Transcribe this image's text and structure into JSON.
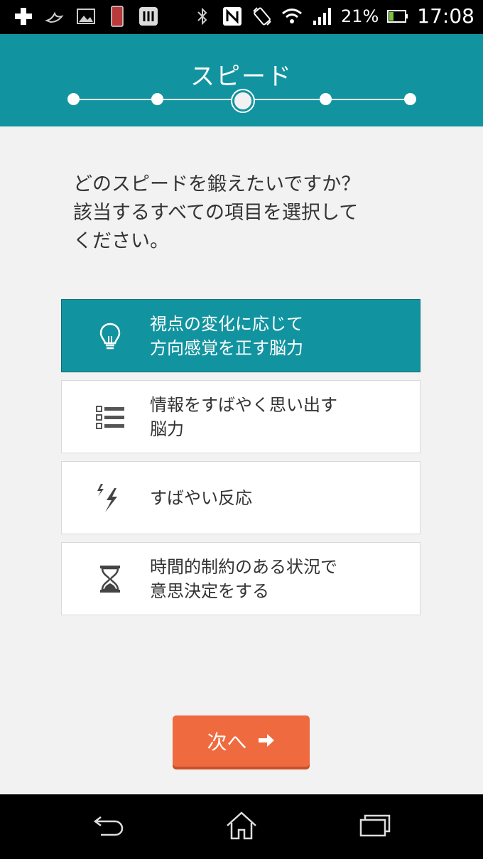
{
  "status_bar": {
    "icons_left": [
      "add-icon",
      "bird-icon",
      "image-icon",
      "phone-icon",
      "app-icon"
    ],
    "icons_right": [
      "bluetooth-icon",
      "nfc-icon",
      "rotate-icon",
      "wifi-icon",
      "signal-icon",
      "battery-icon"
    ],
    "battery_percent": "21%",
    "time": "17:08"
  },
  "header": {
    "title": "スピード",
    "steps_total": 5,
    "current_step": 3
  },
  "question": {
    "text": "どのスピードを鍛えたいですか？\n該当するすべての項目を選択して\nください。"
  },
  "options": [
    {
      "label": "視点の変化に応じて\n方向感覚を正す脳力",
      "icon": "lightbulb-icon",
      "selected": true
    },
    {
      "label": "情報をすばやく思い出す\n脳力",
      "icon": "list-icon",
      "selected": false
    },
    {
      "label": "すばやい反応",
      "icon": "lightning-icon",
      "selected": false
    },
    {
      "label": "時間的制約のある状況で\n意思決定をする",
      "icon": "hourglass-icon",
      "selected": false
    }
  ],
  "next_button": {
    "label": "次へ",
    "icon": "arrow-right-icon"
  },
  "nav_bar": {
    "buttons": [
      "back-icon",
      "home-icon",
      "recents-icon"
    ]
  },
  "colors": {
    "accent": "#1294a0",
    "button": "#f06a3f",
    "background": "#f2f2f2"
  }
}
